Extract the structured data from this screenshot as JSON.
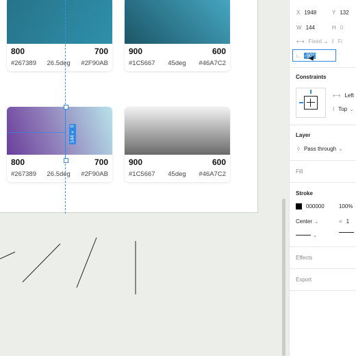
{
  "cards": [
    {
      "name": "800",
      "opacity": "700",
      "color1": "#267389",
      "angle": "26.5deg",
      "color2": "#2F90AB"
    },
    {
      "name": "900",
      "opacity": "600",
      "color1": "#1C5667",
      "angle": "45deg",
      "color2": "#46A7C2"
    },
    {
      "name": "800",
      "opacity": "700",
      "color1": "#267389",
      "angle": "26.5deg",
      "color2": "#2F90AB"
    },
    {
      "name": "900",
      "opacity": "600",
      "color1": "#1C5667",
      "angle": "45deg",
      "color2": "#46A7C2"
    }
  ],
  "selection": {
    "size_label": "144 × 0"
  },
  "panel": {
    "x_label": "X",
    "x_value": "1948",
    "y_label": "Y",
    "y_value": "132",
    "w_label": "W",
    "w_value": "144",
    "h_label": "H",
    "h_value": "0",
    "fixed_label": "Fixed",
    "rotation_value": "-90°",
    "constraints_title": "Constraints",
    "constraint_h": "Left",
    "constraint_v": "Top",
    "layer_title": "Layer",
    "blend_mode": "Pass through",
    "fill_title": "Fill",
    "stroke_title": "Stroke",
    "stroke_color": "000000",
    "stroke_opacity": "100%",
    "stroke_align": "Center",
    "stroke_weight": "1",
    "effects_title": "Effects",
    "export_title": "Export"
  },
  "colors": {
    "accent": "#2e8ae6",
    "canvas": "#eceee9"
  }
}
